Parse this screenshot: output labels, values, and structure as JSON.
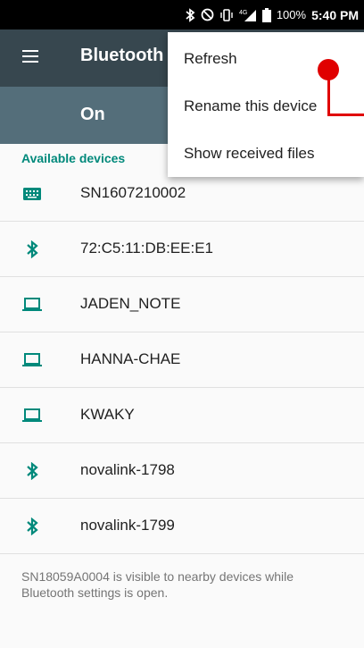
{
  "status_bar": {
    "battery_percent": "100%",
    "time": "5:40 PM",
    "network": "4G",
    "icons": [
      "bluetooth-icon",
      "do-not-disturb-icon",
      "vibrate-icon",
      "signal-icon",
      "battery-icon"
    ]
  },
  "app_bar": {
    "title": "Bluetooth",
    "menu_icon": "hamburger-menu-icon",
    "background": "#37474f"
  },
  "switch_bar": {
    "label": "On",
    "background": "#546e7a"
  },
  "list": {
    "header": "Available devices",
    "accent": "#00897b",
    "devices": [
      {
        "name": "SN1607210002",
        "icon": "keyboard-icon"
      },
      {
        "name": "72:C5:11:DB:EE:E1",
        "icon": "bluetooth-icon"
      },
      {
        "name": "JADEN_NOTE",
        "icon": "laptop-icon"
      },
      {
        "name": "HANNA-CHAE",
        "icon": "laptop-icon"
      },
      {
        "name": "KWAKY",
        "icon": "laptop-icon"
      },
      {
        "name": "novalink-1798",
        "icon": "bluetooth-icon"
      },
      {
        "name": "novalink-1799",
        "icon": "bluetooth-icon"
      }
    ]
  },
  "footer": {
    "note": "SN18059A0004 is visible to nearby devices while Bluetooth settings is open."
  },
  "overflow_menu": {
    "items": [
      {
        "label": "Refresh"
      },
      {
        "label": "Rename this device"
      },
      {
        "label": "Show received files"
      }
    ]
  },
  "annotation": {
    "color": "#e00000"
  }
}
